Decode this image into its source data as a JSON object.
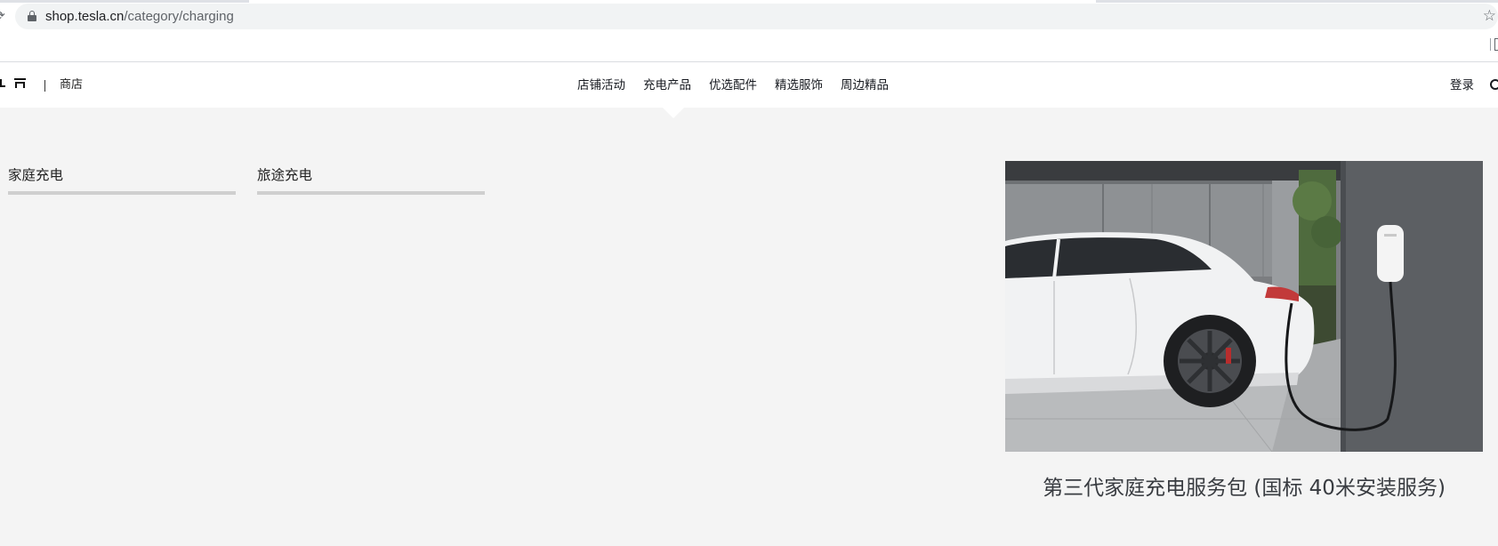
{
  "browser": {
    "url_host": "shop.tesla.cn",
    "url_path": "/category/charging",
    "bookmark_icon": "star-icon",
    "secure_icon": "lock-icon"
  },
  "header": {
    "logo_icon": "tesla-logo",
    "store_label": "商店",
    "nav": [
      {
        "label": "店铺活动"
      },
      {
        "label": "充电产品"
      },
      {
        "label": "优选配件"
      },
      {
        "label": "精选服饰"
      },
      {
        "label": "周边精品"
      }
    ],
    "login_label": "登录",
    "search_icon": "search-icon"
  },
  "category_tabs": [
    {
      "label": "家庭充电"
    },
    {
      "label": "旅途充电"
    }
  ],
  "product": {
    "title": "第三代家庭充电服务包 (国标 40米安装服务)",
    "image_icon": "car-charging-photo"
  },
  "colors": {
    "page_bg": "#f4f4f4",
    "header_bg": "#ffffff",
    "tab_underline": "#cfcfcf",
    "title_text": "#393c41"
  }
}
